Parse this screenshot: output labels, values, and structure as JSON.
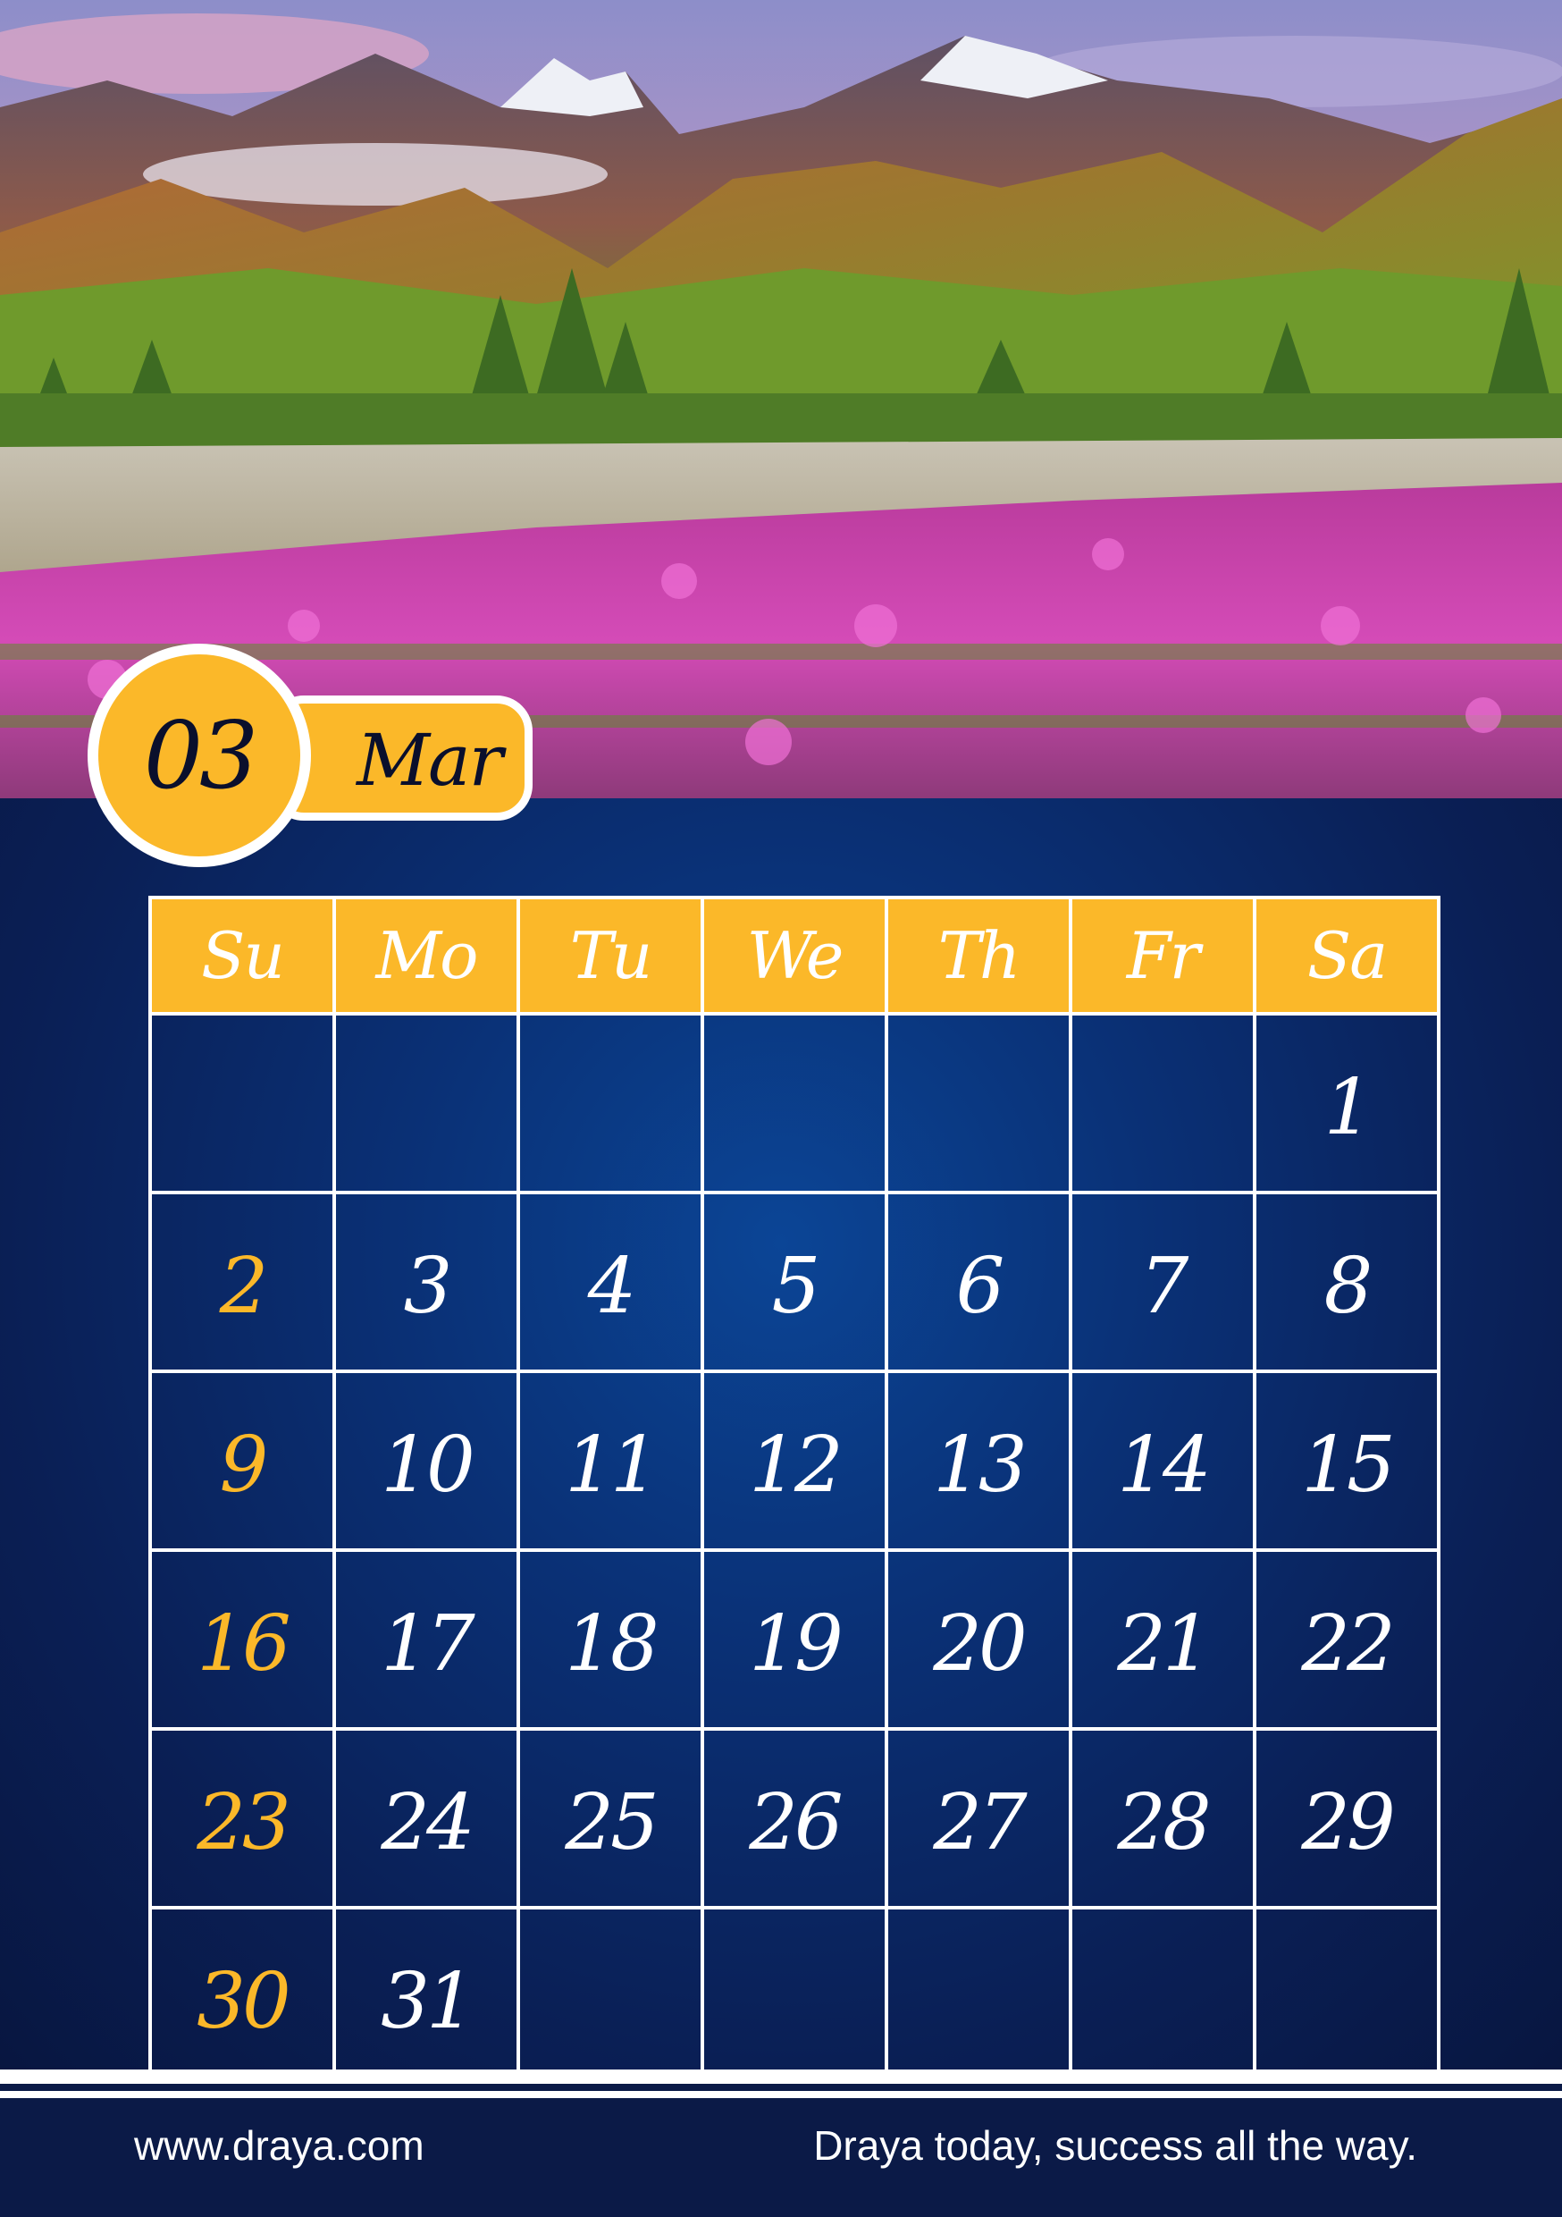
{
  "badge": {
    "number": "03",
    "month": "Mar"
  },
  "calendar": {
    "weekdays": [
      "Su",
      "Mo",
      "Tu",
      "We",
      "Th",
      "Fr",
      "Sa"
    ],
    "weeks": [
      [
        "",
        "",
        "",
        "",
        "",
        "",
        "1"
      ],
      [
        "2",
        "3",
        "4",
        "5",
        "6",
        "7",
        "8"
      ],
      [
        "9",
        "10",
        "11",
        "12",
        "13",
        "14",
        "15"
      ],
      [
        "16",
        "17",
        "18",
        "19",
        "20",
        "21",
        "22"
      ],
      [
        "23",
        "24",
        "25",
        "26",
        "27",
        "28",
        "29"
      ],
      [
        "30",
        "31",
        "",
        "",
        "",
        "",
        ""
      ]
    ]
  },
  "footer": {
    "url": "www.draya.com",
    "slogan": "Draya today, success all the way."
  },
  "colors": {
    "accent": "#fbb829",
    "panel": "#0a3075",
    "footer": "#0b1a47"
  }
}
